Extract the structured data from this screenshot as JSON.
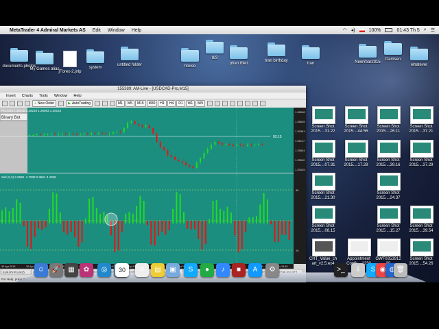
{
  "menubar": {
    "app_name": "MetaTrader 4 Admiral Markets AS",
    "items": [
      "Edit",
      "Window",
      "Help"
    ],
    "battery": "100%",
    "clock": "01:43 Th 5"
  },
  "desktop_left": [
    {
      "label": "documents photos"
    },
    {
      "label": "My Games alias"
    },
    {
      "label": "jForex-2.jnlp"
    },
    {
      "label": "system"
    },
    {
      "label": "untitled folder"
    }
  ],
  "desktop_top": [
    {
      "label": "house"
    },
    {
      "label": "8/3"
    },
    {
      "label": "phan thiet"
    },
    {
      "label": "tran birthday"
    },
    {
      "label": "tran"
    },
    {
      "label": "NewYear2015"
    },
    {
      "label": "Damsen"
    },
    {
      "label": "whatever"
    }
  ],
  "mt4": {
    "title": "155389: AM-Live - [USDCAD-Pro,M15]",
    "menu": [
      "Insert",
      "Charts",
      "Tools",
      "Window",
      "Help"
    ],
    "toolbar": {
      "new_order": "New Order",
      "autotrading": "AutoTrading"
    },
    "timeframes": [
      "M1",
      "M5",
      "M15",
      "M30",
      "H1",
      "H4",
      "D1",
      "W1",
      "MN"
    ],
    "binary_bot_label": "Binary Bot",
    "main_header": "Pro,M15 1.26145 1.26218 1.26083 1.26144",
    "indicator_header": "Sell (5,3) 3.2658 -1.7938 0.3661 3.4359",
    "price_marker": "02:15",
    "price_labels": [
      "1.26908",
      "1.26645",
      "1.26381",
      "1.26117",
      "1.25854",
      "1.25590",
      "1.25425"
    ],
    "ind_scale": [
      "80",
      "20"
    ],
    "time_axis": [
      "30 Apr 2015",
      "30 Apr 04:45",
      "30 Apr 06:45",
      "30 Apr 07:45",
      "30 Apr 08:45",
      "30 Apr 09:45",
      "30 Apr 10:45",
      "30 Apr 11:45",
      "30 Apr 12:45",
      "30 Apr 13:45",
      "30 Apr 14:45",
      "30 Apr 15:45"
    ],
    "tabs": [
      "EURJPY-Pro,M15",
      "GBPJPY-Pro,M15",
      "GBPUSD-Pro,M15",
      "EURUSD-Pro,M15",
      "AUDUSD-Pro,M15",
      "USDCAD-Pro,M15",
      "EURGBP-Pro,M15",
      "CADJPY-Pro,M15",
      "GBPCAD-Pro,M15",
      "GBPCHF-Pro,M15"
    ],
    "status_left": "For Help, press F1",
    "status_mid": "Default",
    "colors": {
      "chart_bg": "#1b8e80",
      "bull": "#22dd22",
      "bear": "#ee1111",
      "grid": "#7fd0c3",
      "panel": "#d8d8d8"
    }
  },
  "screenshots": [
    {
      "l1": "Screen Shot",
      "l2": "2015....31.22"
    },
    {
      "l1": "Screen Shot",
      "l2": "2015....44.56"
    },
    {
      "l1": "Screen Shot",
      "l2": "2015....26.11"
    },
    {
      "l1": "Screen Shot",
      "l2": "2015....37.21"
    },
    {
      "l1": "Screen Shot",
      "l2": "2015....07.31"
    },
    {
      "l1": "Screen Shot",
      "l2": "2015....17.28"
    },
    {
      "l1": "Screen Shot",
      "l2": "2015....39.16"
    },
    {
      "l1": "Screen Shot",
      "l2": "2015....37.29"
    },
    {
      "l1": "Screen Shot",
      "l2": "2015....21.30"
    },
    {
      "l1": "Screen Shot",
      "l2": "2015....24.37"
    },
    {
      "l1": "Screen Shot",
      "l2": "2015....08.15"
    },
    {
      "l1": "Screen Shot",
      "l2": "2015....15.27"
    },
    {
      "l1": "Screen Shot",
      "l2": "2015....39.54"
    }
  ],
  "desktop_files": [
    {
      "l1": "CHT_Value_ch",
      "l2": "art_v2.5.ex4"
    },
    {
      "l1": "Appointment",
      "l2": "Confir....1230"
    },
    {
      "l1": "GWF0353912",
      "l2": "30"
    },
    {
      "l1": "Screen Shot",
      "l2": "2015....54.26"
    }
  ],
  "dock": {
    "calendar_day": "30"
  }
}
